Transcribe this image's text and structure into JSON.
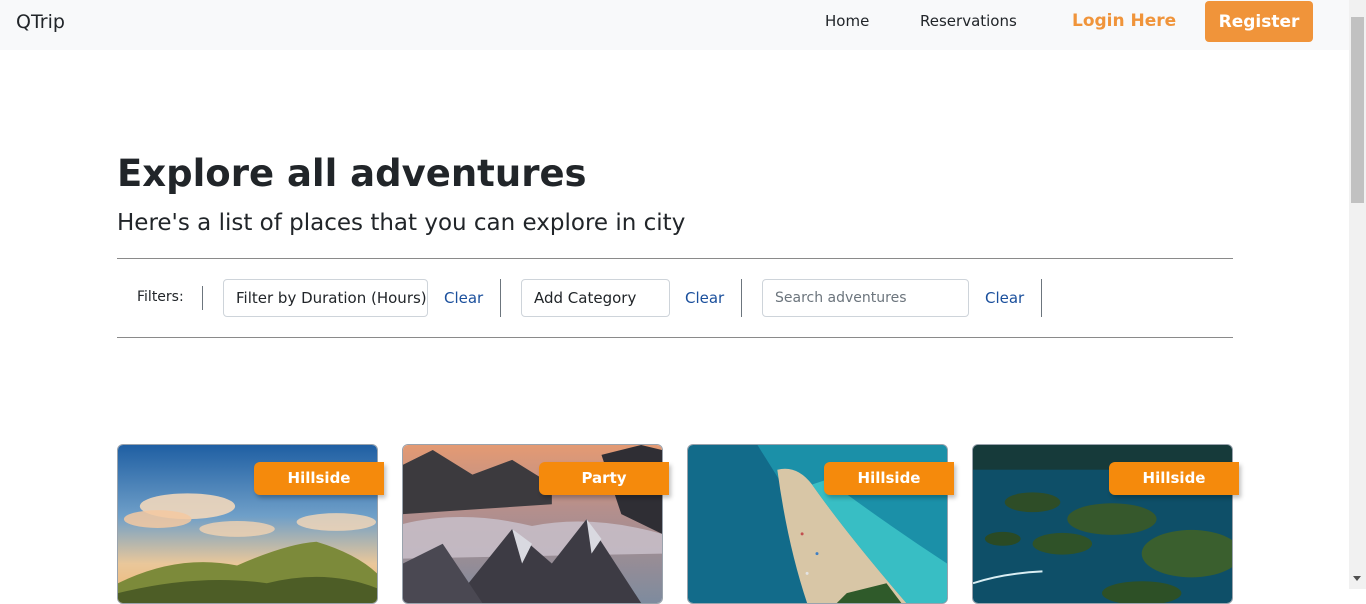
{
  "navbar": {
    "brand": "QTrip",
    "links": [
      "Home",
      "Reservations"
    ],
    "login": "Login Here",
    "register": "Register",
    "accent_color": "#f0943a"
  },
  "main": {
    "title": "Explore all adventures",
    "subtitle": "Here's a list of places that you can explore in city"
  },
  "filters": {
    "label": "Filters:",
    "duration_select": "Filter by Duration (Hours)",
    "category_select": "Add Category",
    "search_placeholder": "Search adventures",
    "clear_label": "Clear",
    "link_color": "#1a4f9c"
  },
  "adventures": [
    {
      "category": "Hillside",
      "image": "hillside-sunset-landscape"
    },
    {
      "category": "Party",
      "image": "mountain-peaks-above-clouds"
    },
    {
      "category": "Hillside",
      "image": "aerial-beach-spit"
    },
    {
      "category": "Hillside",
      "image": "aerial-tropical-islands"
    }
  ],
  "badge_color": "#f58a0c"
}
